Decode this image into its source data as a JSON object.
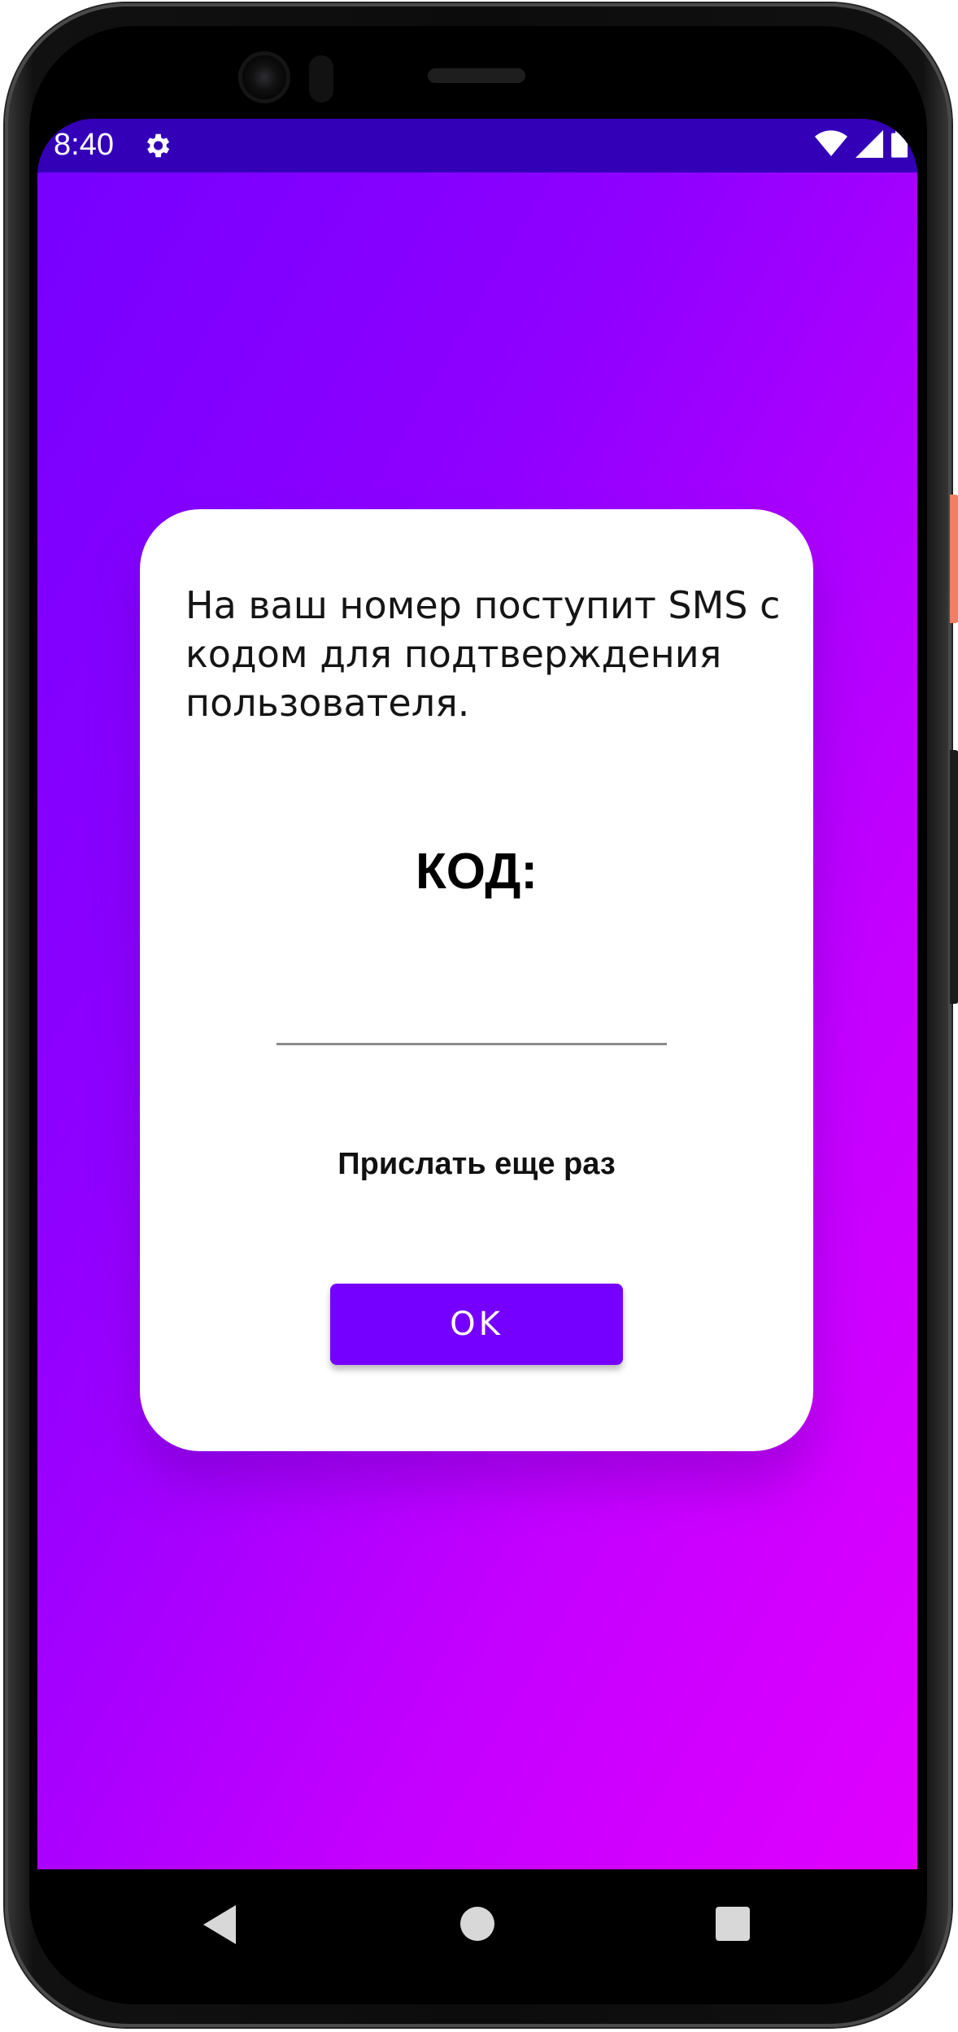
{
  "status_bar": {
    "time": "8:40",
    "icons": [
      "settings-gear-icon",
      "wifi-icon",
      "signal-icon",
      "battery-icon"
    ],
    "color": "#3300b8"
  },
  "dialog": {
    "message": "На ваш номер поступит SMS с кодом для подтверждения пользователя.",
    "code_label": "КОД:",
    "code_input": {
      "value": "",
      "placeholder": ""
    },
    "resend_link": "Прислать еще раз",
    "ok_button": "OK"
  },
  "colors": {
    "background_gradient_start": "#7500ff",
    "background_gradient_end": "#e000ff",
    "button": "#7500ff",
    "dialog_background": "#ffffff"
  },
  "navigation": {
    "buttons": [
      "back-icon",
      "home-icon",
      "recents-icon"
    ]
  }
}
